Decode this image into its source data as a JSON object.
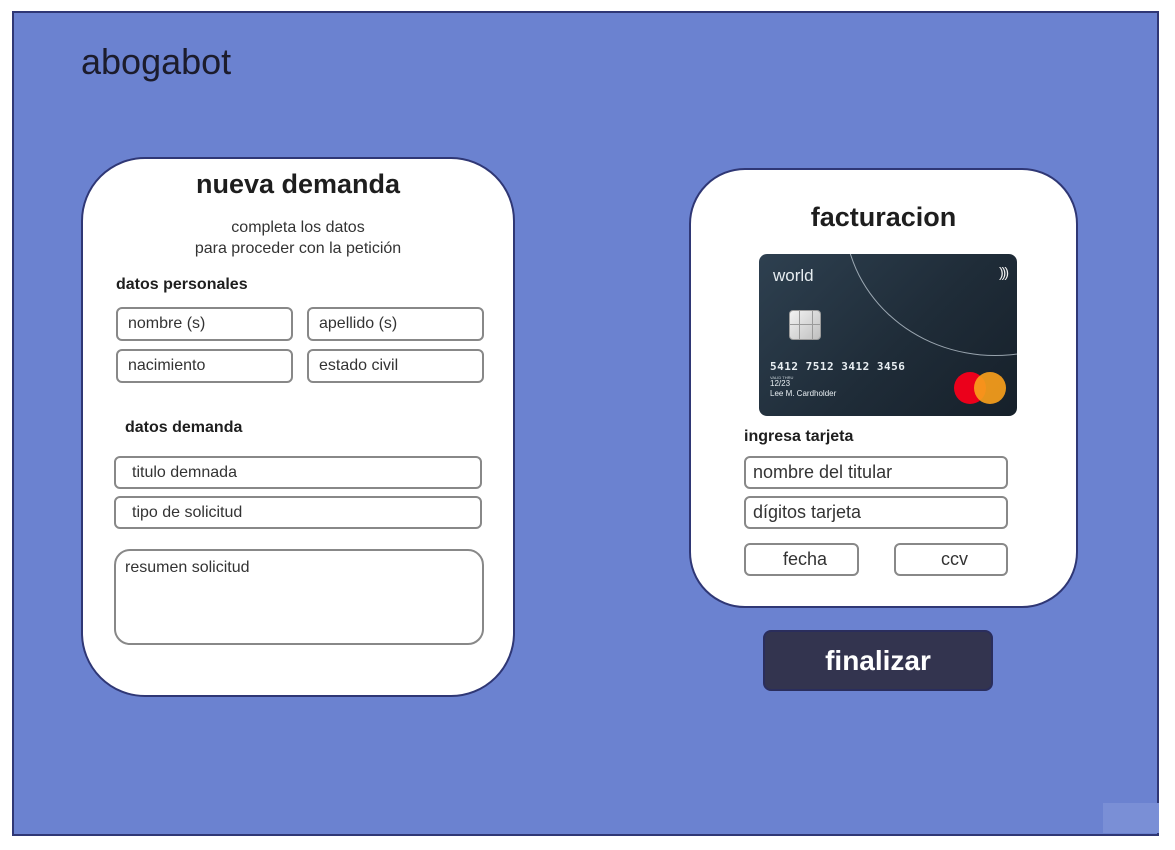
{
  "app": {
    "title": "abogabot"
  },
  "demanda": {
    "title": "nueva demanda",
    "subtitle_line1": "completa los datos",
    "subtitle_line2": "para proceder con la petición",
    "personal_label": "datos personales",
    "fields": {
      "nombre": "nombre (s)",
      "apellido": "apellido (s)",
      "nacimiento": "nacimiento",
      "estado_civil": "estado civil"
    },
    "demanda_label": "datos demanda",
    "titulo": "titulo demnada",
    "tipo": "tipo de solicitud",
    "resumen": "resumen solicitud"
  },
  "facturacion": {
    "title": "facturacion",
    "card_image": {
      "brand": "world",
      "contactless": ")))",
      "number": "5412 7512 3412 3456",
      "valid_label": "VALID THRU",
      "expiry": "12/23",
      "holder": "Lee M. Cardholder"
    },
    "card_label": "ingresa tarjeta",
    "titular": "nombre del titular",
    "digitos": "dígitos tarjeta",
    "fecha": "fecha",
    "ccv": "ccv"
  },
  "actions": {
    "finalizar": "finalizar"
  },
  "colors": {
    "background": "#6b82d0",
    "border": "#2f3775",
    "button": "#33344f"
  }
}
